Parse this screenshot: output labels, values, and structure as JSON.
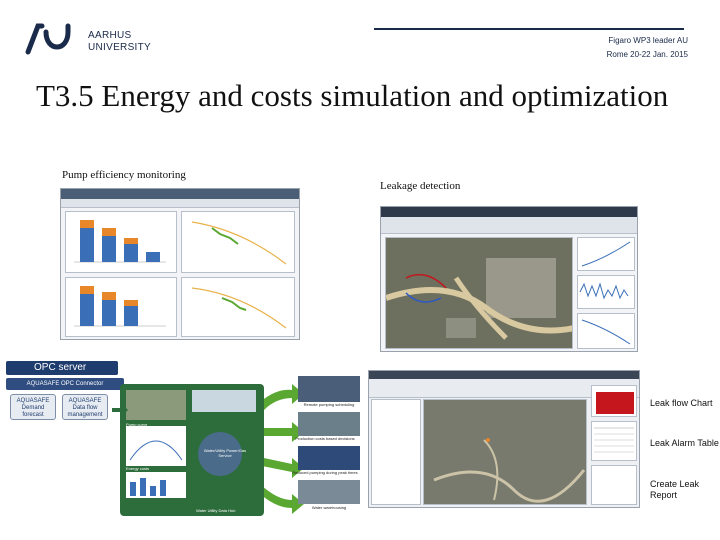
{
  "header": {
    "university_line1": "AARHUS",
    "university_line2": "UNIVERSITY",
    "right_line1": "Figaro WP3 leader AU",
    "right_line2": "Rome 20-22 Jan. 2015"
  },
  "title": "T3.5 Energy and costs simulation and optimization",
  "captions": {
    "pump": "Pump efficiency monitoring",
    "leakage": "Leakage detection"
  },
  "opc": {
    "server": "OPC server",
    "connector": "AQUASAFE OPC Connector",
    "box1": "AQUASAFE Demand forecast",
    "box2": "AQUASAFE Data flow management",
    "center_line1": "Water/Utility Power/Gas",
    "center_line2": "Service",
    "photo_labels": [
      "Remote pumping scheduling",
      "Production costs based decisions",
      "Reduced pumping during peak times",
      "Water warehousing"
    ],
    "chart_label1": "Pump curve",
    "chart_label2": "Energy costs",
    "footer": "Water Utility Data Hub"
  },
  "leak_annotations": {
    "flow_chart": "Leak flow Chart",
    "alarm_table": "Leak Alarm Table",
    "create_report": "Create Leak Report"
  },
  "colors": {
    "brand": "#1a2a4a",
    "bar_orange": "#e8862a",
    "bar_blue": "#3a6fb8",
    "alarm_red": "#c4161c",
    "opc_blue": "#1f3c6e",
    "arrow_green": "#5aa832"
  }
}
